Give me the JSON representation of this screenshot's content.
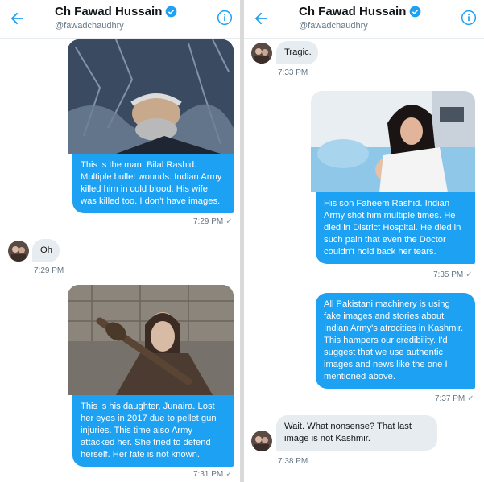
{
  "header": {
    "name": "Ch Fawad Hussain",
    "handle": "@fawadchaudhry",
    "icons": [
      "back-arrow-icon",
      "verified-icon",
      "info-icon"
    ]
  },
  "left_panel": {
    "messages": [
      {
        "direction": "sent",
        "has_image": true,
        "image": "man-lying-in-snow",
        "text": "This is the man, Bilal Rashid. Multiple bullet wounds. Indian Army killed him in cold blood. His wife was killed too. I don't have images.",
        "time": "7:29 PM"
      },
      {
        "direction": "received",
        "text": "Oh",
        "time": "7:29 PM"
      },
      {
        "direction": "sent",
        "has_image": true,
        "image": "girl-holding-club",
        "text": "This is his daughter, Junaira. Lost her eyes in 2017 due to pellet gun injuries. This time also Army attacked her. She tried to defend herself. Her fate is not known.",
        "time": "7:31 PM"
      }
    ]
  },
  "right_panel": {
    "messages": [
      {
        "direction": "received",
        "text": "Tragic.",
        "time": "7:33 PM"
      },
      {
        "direction": "sent",
        "has_image": true,
        "image": "woman-crying-over-patient",
        "text": "His son Faheem Rashid. Indian Army shot him multiple times. He died in District Hospital. He died in such pain that even the Doctor couldn't hold back her tears.",
        "time": "7:35 PM"
      },
      {
        "direction": "sent",
        "text": "All Pakistani machinery is using fake images and stories about Indian Army's atrocities in Kashmir. This hampers our credibility. I'd suggest that we use authentic images and news like the one I mentioned above.",
        "time": "7:37 PM"
      },
      {
        "direction": "received",
        "text": "Wait. What nonsense? That last image is not Kashmir.",
        "time": "7:38 PM"
      }
    ]
  },
  "colors": {
    "accent": "#1da1f2",
    "received_bubble": "#e6ecf0",
    "muted_text": "#657786"
  },
  "read_check": "✓"
}
